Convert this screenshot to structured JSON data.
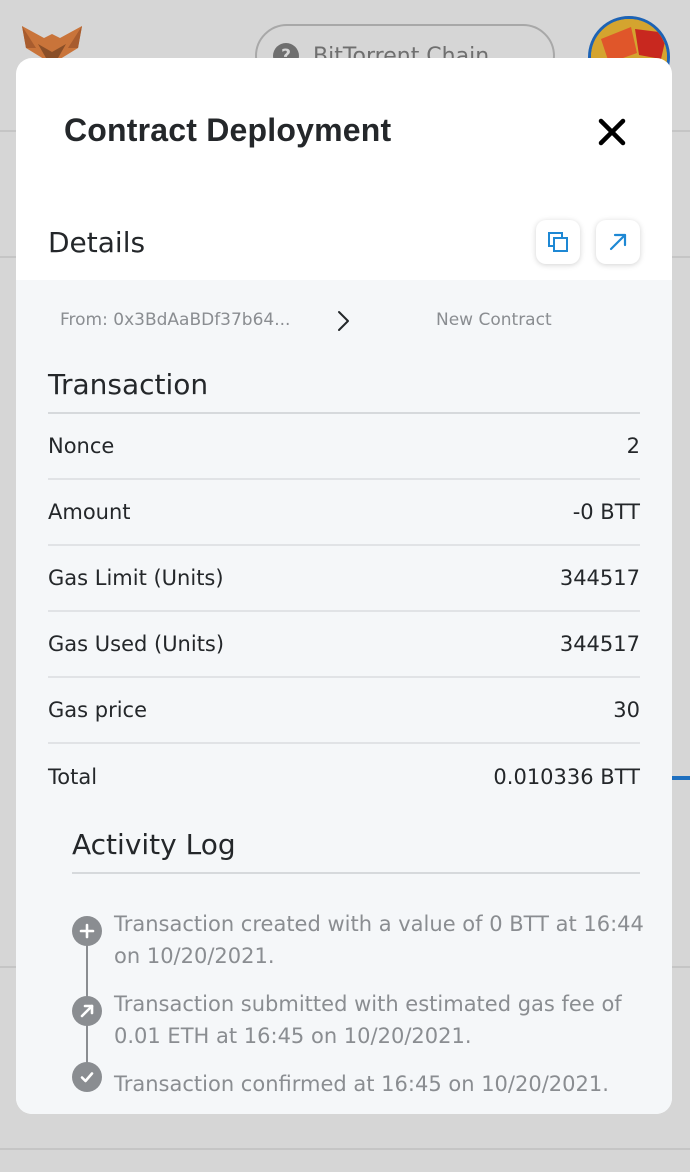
{
  "background": {
    "network_label": "BitTorrent Chain",
    "network_icon": "question-mark-icon"
  },
  "modal": {
    "title": "Contract Deployment",
    "close_icon": "close-icon",
    "details_label": "Details",
    "copy_icon": "copy-icon",
    "explorer_icon": "external-link-icon",
    "from": "From: 0x3BdAaBDf37b64...",
    "to": "New Contract",
    "transaction": {
      "title": "Transaction",
      "rows": [
        {
          "label": "Nonce",
          "value": "2"
        },
        {
          "label": "Amount",
          "value": "-0 BTT"
        },
        {
          "label": "Gas Limit (Units)",
          "value": "344517"
        },
        {
          "label": "Gas Used (Units)",
          "value": "344517"
        },
        {
          "label": "Gas price",
          "value": "30"
        },
        {
          "label": "Total",
          "value": "0.010336 BTT"
        }
      ]
    },
    "activity_log": {
      "title": "Activity Log",
      "entries": [
        {
          "icon": "plus-icon",
          "text": "Transaction created with a value of 0 BTT at 16:44 on 10/20/2021."
        },
        {
          "icon": "arrow-up-right-icon",
          "text": "Transaction submitted with estimated gas fee of 0.01 ETH at 16:45 on 10/20/2021."
        },
        {
          "icon": "check-icon",
          "text": "Transaction confirmed at 16:45 on 10/20/2021."
        }
      ]
    }
  },
  "colors": {
    "overlay_bg": "#d6d6d6",
    "modal_bg": "#ffffff",
    "body_bg": "#f5f7f9",
    "text_primary": "#24272a",
    "text_muted": "#8a8d91",
    "accent_blue": "#1e88d4"
  }
}
